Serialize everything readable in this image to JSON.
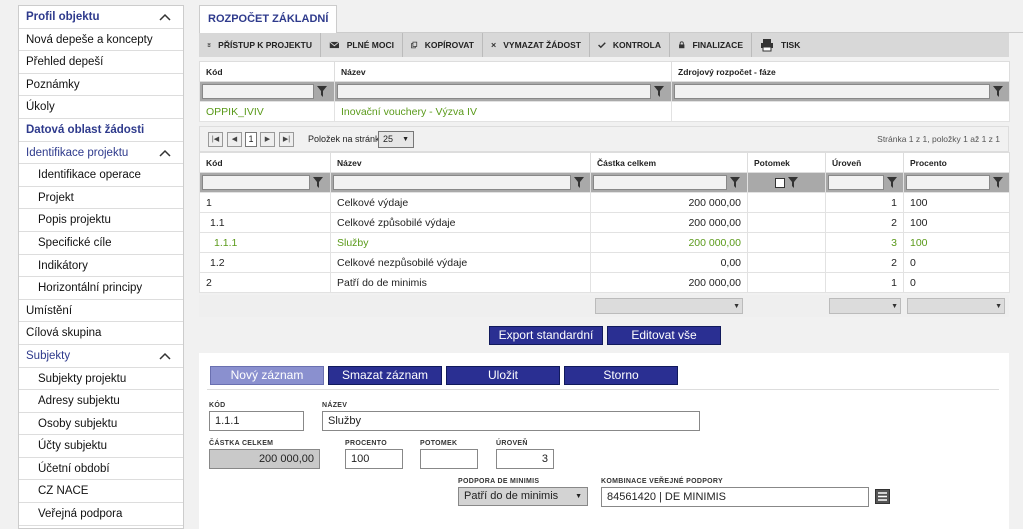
{
  "sidebar": {
    "items": [
      {
        "label": "Profil objektu",
        "kind": "section"
      },
      {
        "label": "Nová depeše a koncepty",
        "kind": "item"
      },
      {
        "label": "Přehled depeší",
        "kind": "item"
      },
      {
        "label": "Poznámky",
        "kind": "item"
      },
      {
        "label": "Úkoly",
        "kind": "item"
      },
      {
        "label": "Datová oblast žádosti",
        "kind": "section"
      },
      {
        "label": "Identifikace projektu",
        "kind": "section-light"
      },
      {
        "label": "Identifikace operace",
        "kind": "sub"
      },
      {
        "label": "Projekt",
        "kind": "sub"
      },
      {
        "label": "Popis projektu",
        "kind": "sub"
      },
      {
        "label": "Specifické cíle",
        "kind": "sub"
      },
      {
        "label": "Indikátory",
        "kind": "sub"
      },
      {
        "label": "Horizontální principy",
        "kind": "sub"
      },
      {
        "label": "Umístění",
        "kind": "item"
      },
      {
        "label": "Cílová skupina",
        "kind": "item"
      },
      {
        "label": "Subjekty",
        "kind": "section-light"
      },
      {
        "label": "Subjekty projektu",
        "kind": "sub"
      },
      {
        "label": "Adresy subjektu",
        "kind": "sub"
      },
      {
        "label": "Osoby subjektu",
        "kind": "sub"
      },
      {
        "label": "Účty subjektu",
        "kind": "sub"
      },
      {
        "label": "Účetní období",
        "kind": "sub"
      },
      {
        "label": "CZ NACE",
        "kind": "sub"
      },
      {
        "label": "Veřejná podpora",
        "kind": "sub"
      }
    ]
  },
  "tab": {
    "label": "ROZPOČET ZÁKLADNÍ"
  },
  "toolbar": {
    "access": "PŘÍSTUP K PROJEKTU",
    "fullpower": "PLNÉ MOCI",
    "copy": "KOPÍROVAT",
    "delete": "VYMAZAT ŽÁDOST",
    "check": "KONTROLA",
    "finalize": "FINALIZACE",
    "print": "TISK"
  },
  "grid1": {
    "headers": {
      "code": "Kód",
      "name": "Název",
      "source": "Zdrojový rozpočet - fáze"
    },
    "row": {
      "code": "OPPIK_IVIV",
      "name": "Inovační vouchery - Výzva IV",
      "source": ""
    }
  },
  "pager": {
    "page": "1",
    "per_page_label": "Položek na stránku",
    "per_page": "25",
    "info": "Stránka 1 z 1, položky 1 až 1 z 1"
  },
  "grid2": {
    "headers": {
      "code": "Kód",
      "name": "Název",
      "total": "Částka celkem",
      "child": "Potomek",
      "level": "Úroveň",
      "percent": "Procento"
    },
    "rows": [
      {
        "code": "1",
        "name": "Celkové výdaje",
        "total": "200 000,00",
        "level": "1",
        "percent": "100"
      },
      {
        "code": "1.1",
        "name": "Celkové způsobilé výdaje",
        "total": "200 000,00",
        "level": "2",
        "percent": "100"
      },
      {
        "code": "1.1.1",
        "name": "Služby",
        "total": "200 000,00",
        "level": "3",
        "percent": "100"
      },
      {
        "code": "1.2",
        "name": "Celkové nezpůsobilé výdaje",
        "total": "0,00",
        "level": "2",
        "percent": "0"
      },
      {
        "code": "2",
        "name": "Patří do de minimis",
        "total": "200 000,00",
        "level": "1",
        "percent": "0"
      }
    ]
  },
  "actions": {
    "export": "Export standardní",
    "edit_all": "Editovat vše",
    "new": "Nový záznam",
    "delete": "Smazat záznam",
    "save": "Uložit",
    "cancel": "Storno"
  },
  "form": {
    "code_label": "KÓD",
    "code_value": "1.1.1",
    "name_label": "NÁZEV",
    "name_value": "Služby",
    "total_label": "ČÁSTKA CELKEM",
    "total_value": "200 000,00",
    "percent_label": "PROCENTO",
    "percent_value": "100",
    "child_label": "POTOMEK",
    "child_value": "",
    "level_label": "ÚROVEŇ",
    "level_value": "3",
    "deminimis_label": "PODPORA DE MINIMIS",
    "deminimis_value": "Patří do de minimis",
    "combo_label": "KOMBINACE VEŘEJNÉ PODPORY",
    "combo_value": "84561420 | DE MINIMIS"
  },
  "colors": {
    "accent": "#2a2f92",
    "section": "#2e3a8c",
    "green": "#5a9a1a"
  }
}
